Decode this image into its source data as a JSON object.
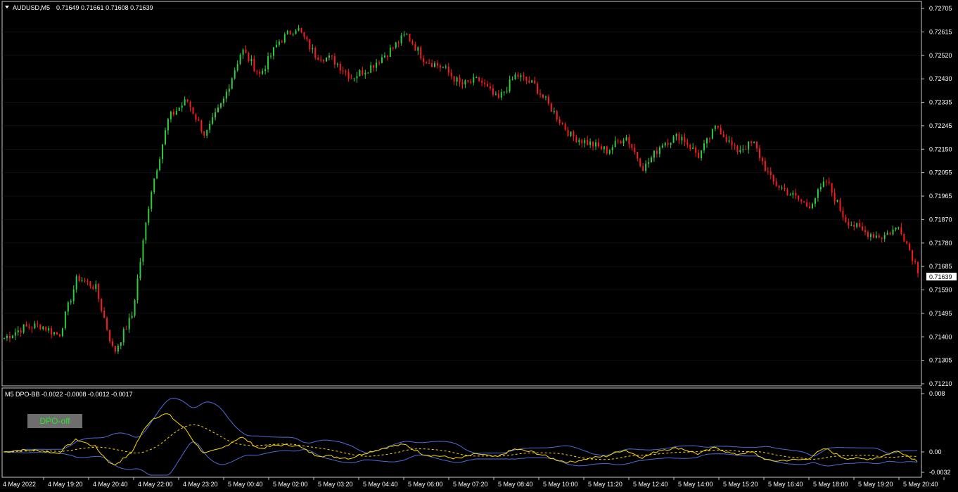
{
  "main_chart": {
    "symbol_label": "AUDUSD,M5",
    "ohlc_readout": "0.71649 0.71661 0.71608 0.71639",
    "current_price_tag": "0.71639",
    "price_axis_labels": [
      "0.72705",
      "0.72615",
      "0.72520",
      "0.72430",
      "0.72335",
      "0.72245",
      "0.72150",
      "0.72055",
      "0.71965",
      "0.71870",
      "0.71780",
      "0.71685",
      "0.71590",
      "0.71495",
      "0.71400",
      "0.71305",
      "0.71210"
    ]
  },
  "indicator": {
    "label": "M5 DPO-BB -0.0022 -0.0008 -0.0012 -0.0017",
    "axis_labels": [
      "0.008",
      "0.00",
      "-0.0032"
    ],
    "toggle_button_label": "DPO-off"
  },
  "time_axis_labels": [
    "4 May 2022",
    "4 May 19:20",
    "4 May 20:40",
    "4 May 22:00",
    "4 May 23:20",
    "5 May 00:40",
    "5 May 02:00",
    "5 May 03:20",
    "5 May 04:40",
    "5 May 06:00",
    "5 May 07:20",
    "5 May 08:40",
    "5 May 10:00",
    "5 May 11:20",
    "5 May 12:40",
    "5 May 14:00",
    "5 May 15:20",
    "5 May 16:40",
    "5 May 18:00",
    "5 May 19:20",
    "5 May 20:40"
  ],
  "colors": {
    "background": "#000000",
    "bull_candle": "#2ecc40",
    "bear_candle": "#ff1a1a",
    "grid": "#1a1a2e",
    "dpo_line": "#ffd700",
    "band_line": "#4f6bd8",
    "mid_line": "#ffd700",
    "text": "#ffffff"
  },
  "chart_data": {
    "type": "line",
    "x": [
      "4 May 2022",
      "4 May 19:20",
      "4 May 20:40",
      "4 May 22:00",
      "4 May 23:20",
      "5 May 00:40",
      "5 May 02:00",
      "5 May 03:20",
      "5 May 04:40",
      "5 May 06:00",
      "5 May 07:20",
      "5 May 08:40",
      "5 May 10:00",
      "5 May 11:20",
      "5 May 12:40",
      "5 May 14:00",
      "5 May 15:20",
      "5 May 16:40",
      "5 May 18:00",
      "5 May 19:20",
      "5 May 20:40"
    ],
    "series": [
      {
        "name": "AUDUSD,M5",
        "values": [
          0.7138,
          0.7142,
          0.7143,
          0.7139,
          0.7162,
          0.7158,
          0.7132,
          0.7147,
          0.7195,
          0.7225,
          0.7232,
          0.7218,
          0.7232,
          0.7252,
          0.7242,
          0.7255,
          0.7261,
          0.725,
          0.7248,
          0.7241,
          0.7245,
          0.7251,
          0.7258,
          0.7248,
          0.7245,
          0.7238,
          0.724,
          0.7232,
          0.7242,
          0.7238,
          0.7228,
          0.7218,
          0.7215,
          0.7212,
          0.7218,
          0.7205,
          0.7215,
          0.7218,
          0.721,
          0.7222,
          0.7212,
          0.7215,
          0.72,
          0.7195,
          0.719,
          0.72,
          0.7185,
          0.718,
          0.7178,
          0.7182,
          0.7165
        ]
      }
    ],
    "ylim": [
      0.7121,
      0.72705
    ],
    "grid": true
  }
}
